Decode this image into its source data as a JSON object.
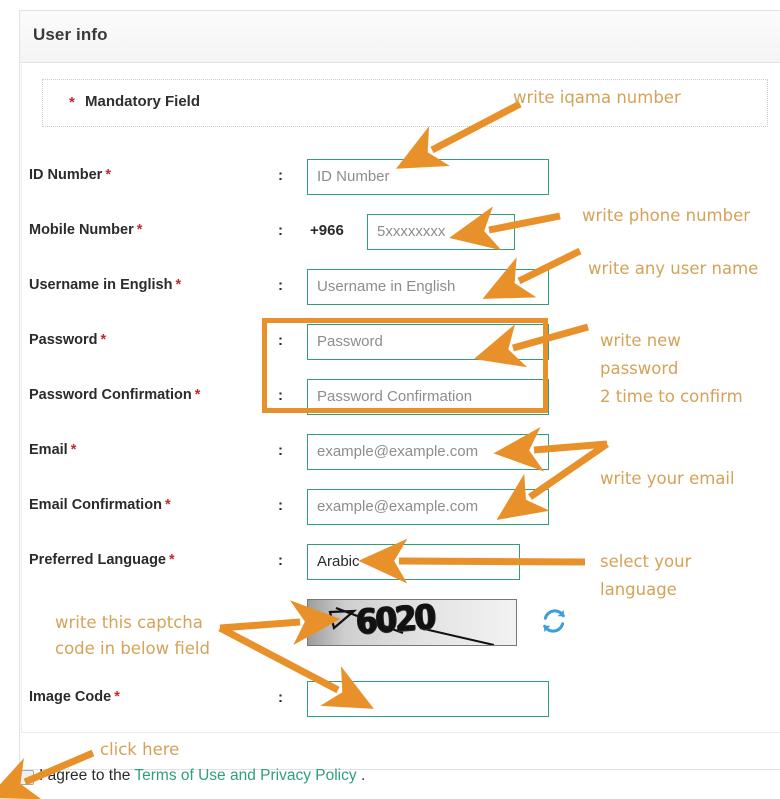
{
  "card": {
    "title": "User info",
    "mandatory_star": "*",
    "mandatory_label": "Mandatory Field"
  },
  "form": {
    "rows": [
      {
        "label": "ID Number",
        "req": "*",
        "colon": ":",
        "placeholder": "ID Number",
        "type": "text"
      },
      {
        "label": "Mobile Number",
        "req": "*",
        "colon": ":",
        "placeholder": "5xxxxxxxx",
        "type": "phone",
        "country_code": "+966"
      },
      {
        "label": "Username in English",
        "req": "*",
        "colon": ":",
        "placeholder": "Username in English",
        "type": "text"
      },
      {
        "label": "Password",
        "req": "*",
        "colon": ":",
        "placeholder": "Password",
        "type": "password"
      },
      {
        "label": "Password Confirmation",
        "req": "*",
        "colon": ":",
        "placeholder": "Password Confirmation",
        "type": "password"
      },
      {
        "label": "Email",
        "req": "*",
        "colon": ":",
        "placeholder": "example@example.com",
        "type": "email"
      },
      {
        "label": "Email Confirmation",
        "req": "*",
        "colon": ":",
        "placeholder": "example@example.com",
        "type": "email"
      },
      {
        "label": "Preferred Language",
        "req": "*",
        "colon": ":",
        "value": "Arabic",
        "type": "select"
      },
      {
        "label": "Image Code",
        "req": "*",
        "colon": ":",
        "placeholder": "",
        "type": "text"
      }
    ]
  },
  "captcha": {
    "code": "6020",
    "refresh_icon": "refresh-icon"
  },
  "agreement": {
    "checkbox_checked": false,
    "prefix": "I agree to the",
    "link": "Terms of Use and Privacy Policy",
    "suffix": "."
  },
  "annotations": {
    "iqama": "write iqama number",
    "phone": "write phone number",
    "username": "write any user name",
    "password_l1": "write new",
    "password_l2": "password",
    "password_l3": "2 time to confirm",
    "email": "write your email",
    "language_l1": "select your",
    "language_l2": "language",
    "captcha_l1": "write this captcha",
    "captcha_l2": "code in below field",
    "click_here": "click here"
  },
  "colors": {
    "input_border": "#2f9e7e",
    "link": "#2f9e7e",
    "required_star": "#c02b2b",
    "annotation_text": "#d5a258",
    "annotation_arrow": "#e8912a",
    "highlight_box": "#e8912a",
    "refresh_icon": "#3c9fd8",
    "header_bg": "#f4f4f4"
  }
}
